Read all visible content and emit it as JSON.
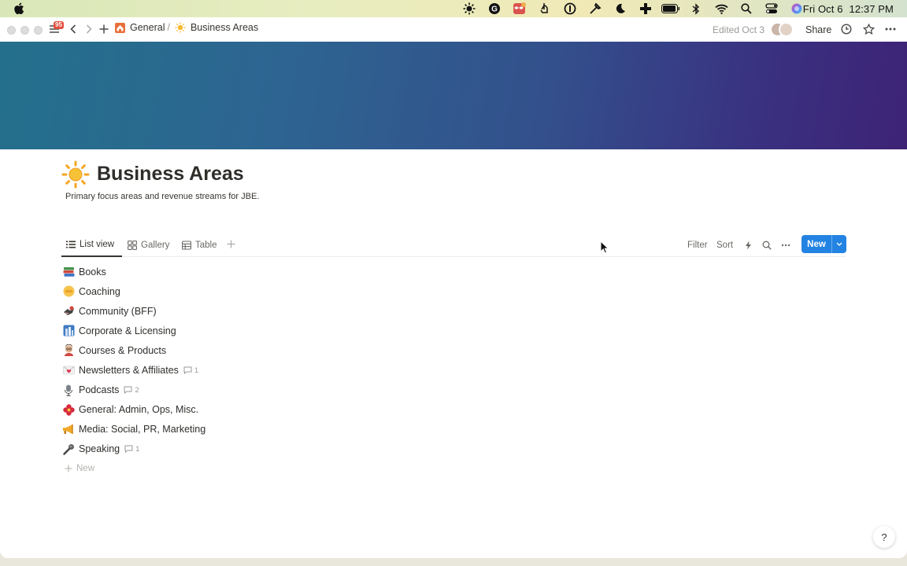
{
  "menubar": {
    "date": "Fri Oct 6",
    "time": "12:37 PM",
    "icons": [
      "settings-sun-icon",
      "grammarly-icon",
      "dropbox-icon",
      "hand-icon",
      "onepassword-icon",
      "tool-icon",
      "night-icon",
      "health-plus-icon",
      "battery-icon",
      "bluetooth-icon",
      "wifi-icon",
      "search-icon",
      "control-center-icon",
      "siri-icon"
    ]
  },
  "titlebar": {
    "badge_count": "95",
    "breadcrumb_parent": "General",
    "breadcrumb_separator": "/",
    "breadcrumb_current": "Business Areas",
    "edited": "Edited Oct 3",
    "share_label": "Share"
  },
  "page": {
    "title": "Business Areas",
    "description": "Primary focus areas and revenue streams for JBE."
  },
  "views": {
    "tabs": [
      {
        "label": "List view",
        "icon": "list-icon"
      },
      {
        "label": "Gallery",
        "icon": "gallery-icon"
      },
      {
        "label": "Table",
        "icon": "table-icon"
      }
    ],
    "filter_label": "Filter",
    "sort_label": "Sort",
    "new_label": "New"
  },
  "items": [
    {
      "label": "Books",
      "icon": "books-emoji-icon",
      "comments": ""
    },
    {
      "label": "Coaching",
      "icon": "coaching-emoji-icon",
      "comments": ""
    },
    {
      "label": "Community (BFF)",
      "icon": "community-emoji-icon",
      "comments": ""
    },
    {
      "label": "Corporate & Licensing",
      "icon": "city-emoji-icon",
      "comments": ""
    },
    {
      "label": "Courses & Products",
      "icon": "teacher-emoji-icon",
      "comments": ""
    },
    {
      "label": "Newsletters & Affiliates",
      "icon": "love-letter-emoji-icon",
      "comments": "1"
    },
    {
      "label": "Podcasts",
      "icon": "microphone-emoji-icon",
      "comments": "2"
    },
    {
      "label": "General: Admin, Ops, Misc.",
      "icon": "flower-emoji-icon",
      "comments": ""
    },
    {
      "label": "Media: Social, PR, Marketing",
      "icon": "megaphone-emoji-icon",
      "comments": ""
    },
    {
      "label": "Speaking",
      "icon": "mic-emoji-icon",
      "comments": "1"
    }
  ],
  "new_row_label": "New",
  "help_label": "?",
  "colors": {
    "accent": "#2383e2",
    "cover_start": "#24708c",
    "cover_end": "#3e2375"
  }
}
